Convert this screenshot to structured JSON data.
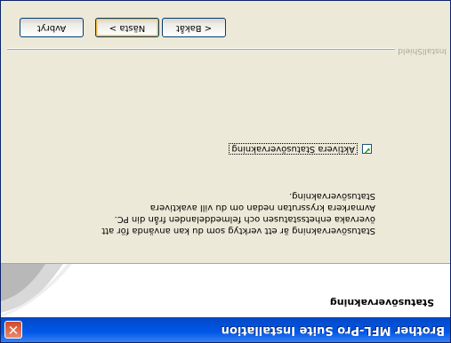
{
  "window": {
    "title": "Brother MFL-Pro Suite Installation",
    "close_glyph": "✕"
  },
  "header": {
    "title": "Statusövervakning"
  },
  "content": {
    "description_lines": [
      "Statusövervakning är ett verktyg som du kan använda för att",
      "övervaka enhetsstatusen och felmeddelanden från din PC.",
      "Avmarkera kryssrutan nedan om du vill avaktivera",
      "Statusövervakning."
    ],
    "checkbox": {
      "label": "Aktivera Statusövervakning",
      "checked": true
    }
  },
  "footer": {
    "installshield_label": "InstallShield",
    "buttons": {
      "back": "< Bakåt",
      "next": "Nästa >",
      "cancel": "Avbryt"
    }
  },
  "colors": {
    "titlebar": "#0058e6",
    "dialog_bg": "#ece9d8",
    "close_button": "#d2482a"
  }
}
